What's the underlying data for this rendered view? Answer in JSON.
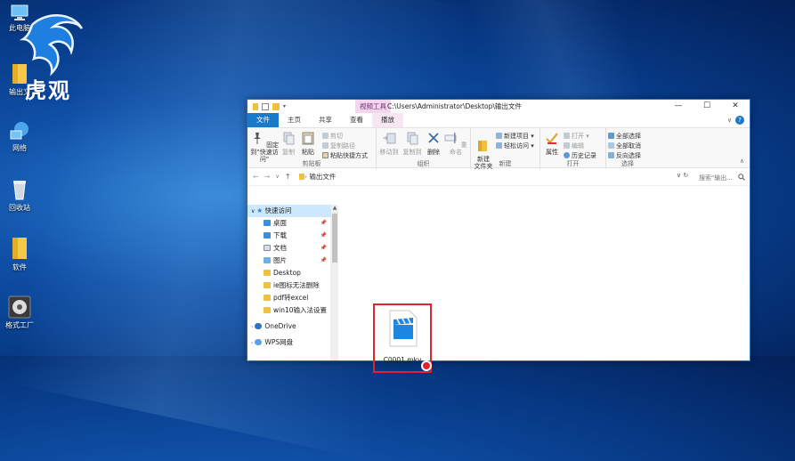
{
  "desktop": {
    "brand_text": "虎观",
    "icons": [
      {
        "label": "此电脑",
        "icon": "computer-icon"
      },
      {
        "label": "输出文",
        "icon": "folder-icon"
      },
      {
        "label": "网络",
        "icon": "network-icon"
      },
      {
        "label": "回收站",
        "icon": "recycle-bin-icon"
      },
      {
        "label": "软件",
        "icon": "folder-icon"
      },
      {
        "label": "格式工厂",
        "icon": "format-factory-icon"
      }
    ]
  },
  "window": {
    "context_tab": "视频工具",
    "title_path": "C:\\Users\\Administrator\\Desktop\\输出文件",
    "tabs": [
      "文件",
      "主页",
      "共享",
      "查看",
      "播放"
    ],
    "ribbon": {
      "clipboard": {
        "group": "剪贴板",
        "pin": "固定到\"快速访问\"",
        "copy": "复制",
        "paste": "粘贴",
        "cut": "剪切",
        "copy_path": "复制路径",
        "paste_shortcut": "粘贴快捷方式"
      },
      "organize": {
        "group": "组织",
        "move_to": "移动到",
        "copy_to": "复制到",
        "delete": "删除",
        "rename": "重命名"
      },
      "new": {
        "group": "新建",
        "new_folder": "新建\n文件夹",
        "new_item": "新建项目",
        "easy_access": "轻松访问"
      },
      "open": {
        "group": "打开",
        "properties": "属性",
        "open": "打开",
        "edit": "编辑",
        "history": "历史记录"
      },
      "select": {
        "group": "选择",
        "select_all": "全部选择",
        "select_none": "全部取消",
        "invert": "反向选择"
      }
    },
    "address": {
      "crumb": "输出文件",
      "search_placeholder": "搜索\"输出..."
    },
    "nav": [
      {
        "label": "快速访问",
        "type": "quick"
      },
      {
        "label": "桌面",
        "pinned": true
      },
      {
        "label": "下载",
        "pinned": true
      },
      {
        "label": "文档",
        "pinned": true
      },
      {
        "label": "图片",
        "pinned": true
      },
      {
        "label": "Desktop"
      },
      {
        "label": "ie图标无法删除"
      },
      {
        "label": "pdf转excel"
      },
      {
        "label": "win10输入法设置"
      },
      {
        "label": "OneDrive"
      },
      {
        "label": "WPS网盘"
      }
    ],
    "file": {
      "name": "C0001.mkv",
      "icon": "video-file-icon"
    }
  }
}
